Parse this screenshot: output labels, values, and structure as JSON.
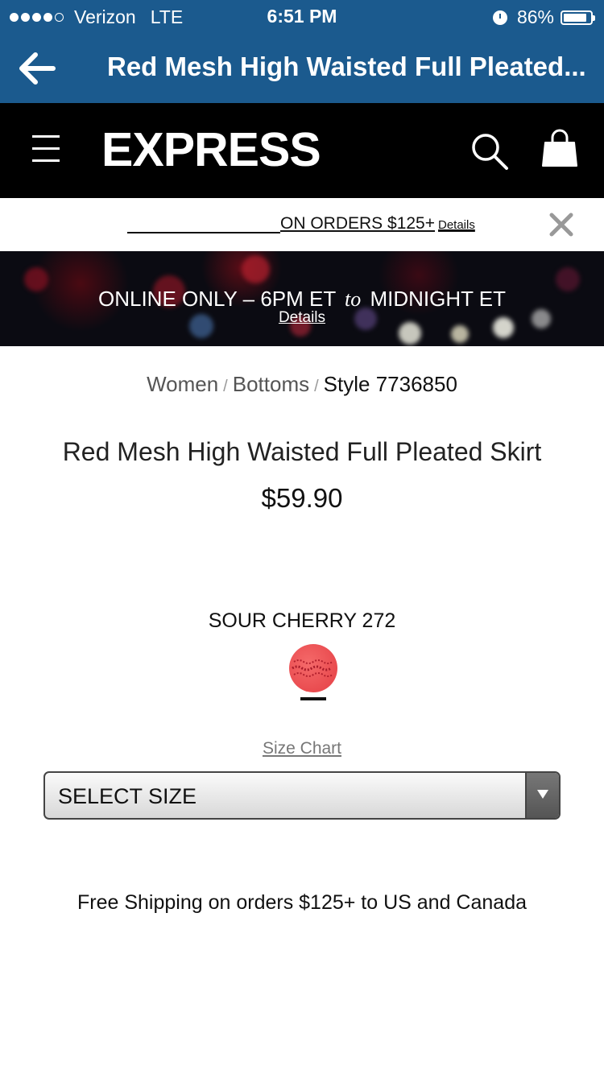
{
  "status_bar": {
    "carrier": "Verizon",
    "network": "LTE",
    "time": "6:51 PM",
    "battery": "86%",
    "signal_bars_filled": 4,
    "signal_bars_total": 5
  },
  "app_bar": {
    "title": "Red Mesh High Waisted Full Pleated...",
    "back_icon": "arrow-left-icon"
  },
  "header": {
    "logo": "EXPRESS",
    "menu_icon": "hamburger-icon",
    "search_icon": "search-icon",
    "bag_icon": "shopping-bag-icon"
  },
  "promo": {
    "text": "ON ORDERS $125+",
    "details": "Details",
    "close_icon": "close-icon"
  },
  "banner": {
    "text_before": "ONLINE ONLY – 6PM ET",
    "text_italic": "to",
    "text_after": "MIDNIGHT ET",
    "details": "Details"
  },
  "breadcrumb": {
    "items": [
      "Women",
      "Bottoms"
    ],
    "separator": "/",
    "style": "Style 7736850"
  },
  "product": {
    "title": "Red Mesh High Waisted Full Pleated Skirt",
    "price": "$59.90",
    "color_name": "SOUR CHERRY 272",
    "swatch_color": "#e94b4f"
  },
  "size": {
    "chart_link": "Size Chart",
    "select_label": "SELECT SIZE"
  },
  "shipping": {
    "text": "Free Shipping on orders $125+ to US and Canada"
  },
  "colors": {
    "nav_blue": "#1b5a8e",
    "header_black": "#000000"
  }
}
